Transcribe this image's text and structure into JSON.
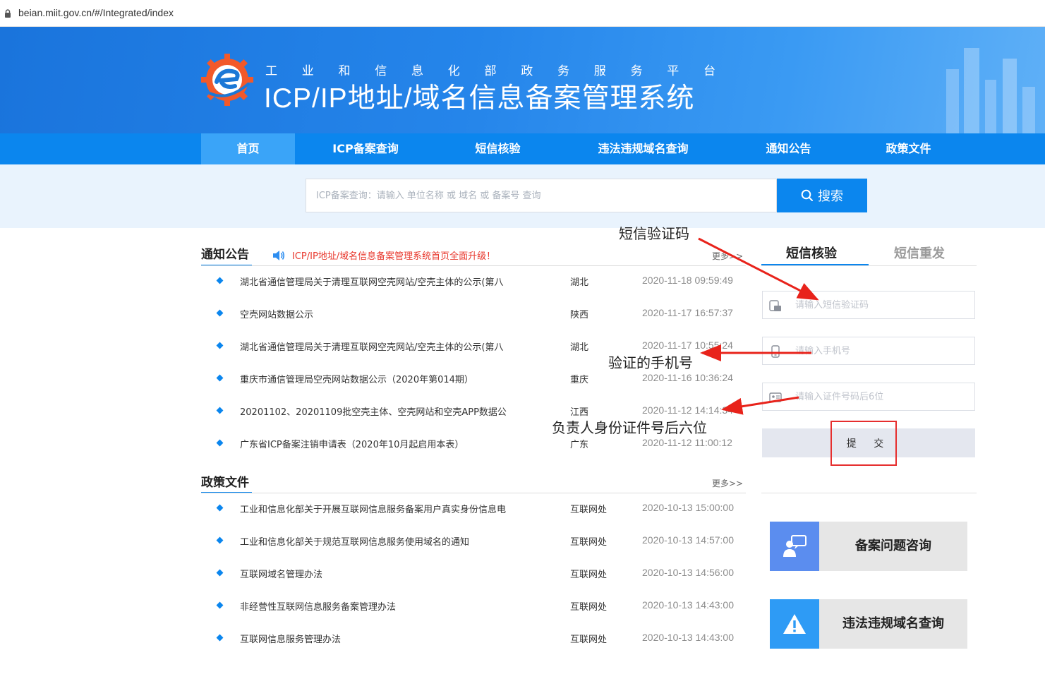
{
  "browser": {
    "url": "beian.miit.gov.cn/#/Integrated/index"
  },
  "header": {
    "subtitle_chars": [
      "工",
      "业",
      "和",
      "信",
      "息",
      "化",
      "部",
      "政",
      "务",
      "服",
      "务",
      "平",
      "台"
    ],
    "title": "ICP/IP地址/域名信息备案管理系统"
  },
  "nav": {
    "items": [
      {
        "label": "首页",
        "active": true
      },
      {
        "label": "ICP备案查询",
        "active": false
      },
      {
        "label": "短信核验",
        "active": false
      },
      {
        "label": "违法违规域名查询",
        "active": false
      },
      {
        "label": "通知公告",
        "active": false
      },
      {
        "label": "政策文件",
        "active": false
      }
    ]
  },
  "search": {
    "placeholder": "ICP备案查询：请输入 单位名称 或 域名 或 备案号 查询",
    "button_label": "搜索"
  },
  "notices": {
    "title": "通知公告",
    "banner": "ICP/IP地址/域名信息备案管理系统首页全面升级！",
    "more": "更多>>",
    "items": [
      {
        "title": "湖北省通信管理局关于清理互联网空壳网站/空壳主体的公示(第八",
        "region": "湖北",
        "date": "2020-11-18 09:59:49"
      },
      {
        "title": "空壳网站数据公示",
        "region": "陕西",
        "date": "2020-11-17 16:57:37"
      },
      {
        "title": "湖北省通信管理局关于清理互联网空壳网站/空壳主体的公示(第八",
        "region": "湖北",
        "date": "2020-11-17 10:55:24"
      },
      {
        "title": "重庆市通信管理局空壳网站数据公示（2020年第014期）",
        "region": "重庆",
        "date": "2020-11-16 10:36:24"
      },
      {
        "title": "20201102、20201109批空壳主体、空壳网站和空壳APP数据公",
        "region": "江西",
        "date": "2020-11-12 14:14:34"
      },
      {
        "title": "广东省ICP备案注销申请表（2020年10月起启用本表）",
        "region": "广东",
        "date": "2020-11-12 11:00:12"
      }
    ]
  },
  "policies": {
    "title": "政策文件",
    "more": "更多>>",
    "items": [
      {
        "title": "工业和信息化部关于开展互联网信息服务备案用户真实身份信息电",
        "region": "互联网处",
        "date": "2020-10-13 15:00:00"
      },
      {
        "title": "工业和信息化部关于规范互联网信息服务使用域名的通知",
        "region": "互联网处",
        "date": "2020-10-13 14:57:00"
      },
      {
        "title": "互联网域名管理办法",
        "region": "互联网处",
        "date": "2020-10-13 14:56:00"
      },
      {
        "title": "非经营性互联网信息服务备案管理办法",
        "region": "互联网处",
        "date": "2020-10-13 14:43:00"
      },
      {
        "title": "互联网信息服务管理办法",
        "region": "互联网处",
        "date": "2020-10-13 14:43:00"
      }
    ]
  },
  "sms_panel": {
    "tabs": [
      {
        "label": "短信核验",
        "active": true
      },
      {
        "label": "短信重发",
        "active": false
      }
    ],
    "code_placeholder": "请输入短信验证码",
    "phone_placeholder": "请输入手机号",
    "id_placeholder": "请输入证件号码后6位",
    "submit_label": "提 交"
  },
  "cards": [
    {
      "label": "备案问题咨询",
      "icon": "consult-icon",
      "color": "#5b8def"
    },
    {
      "label": "违法违规域名查询",
      "icon": "warning-icon",
      "color": "#2e9bf5"
    }
  ],
  "annotations": {
    "sms_code": "短信验证码",
    "phone": "验证的手机号",
    "id_last6": "负责人身份证件号后六位"
  },
  "colors": {
    "primary": "#0b86ee",
    "nav_active": "#3aa4f8",
    "alert_red": "#e62e2e"
  }
}
